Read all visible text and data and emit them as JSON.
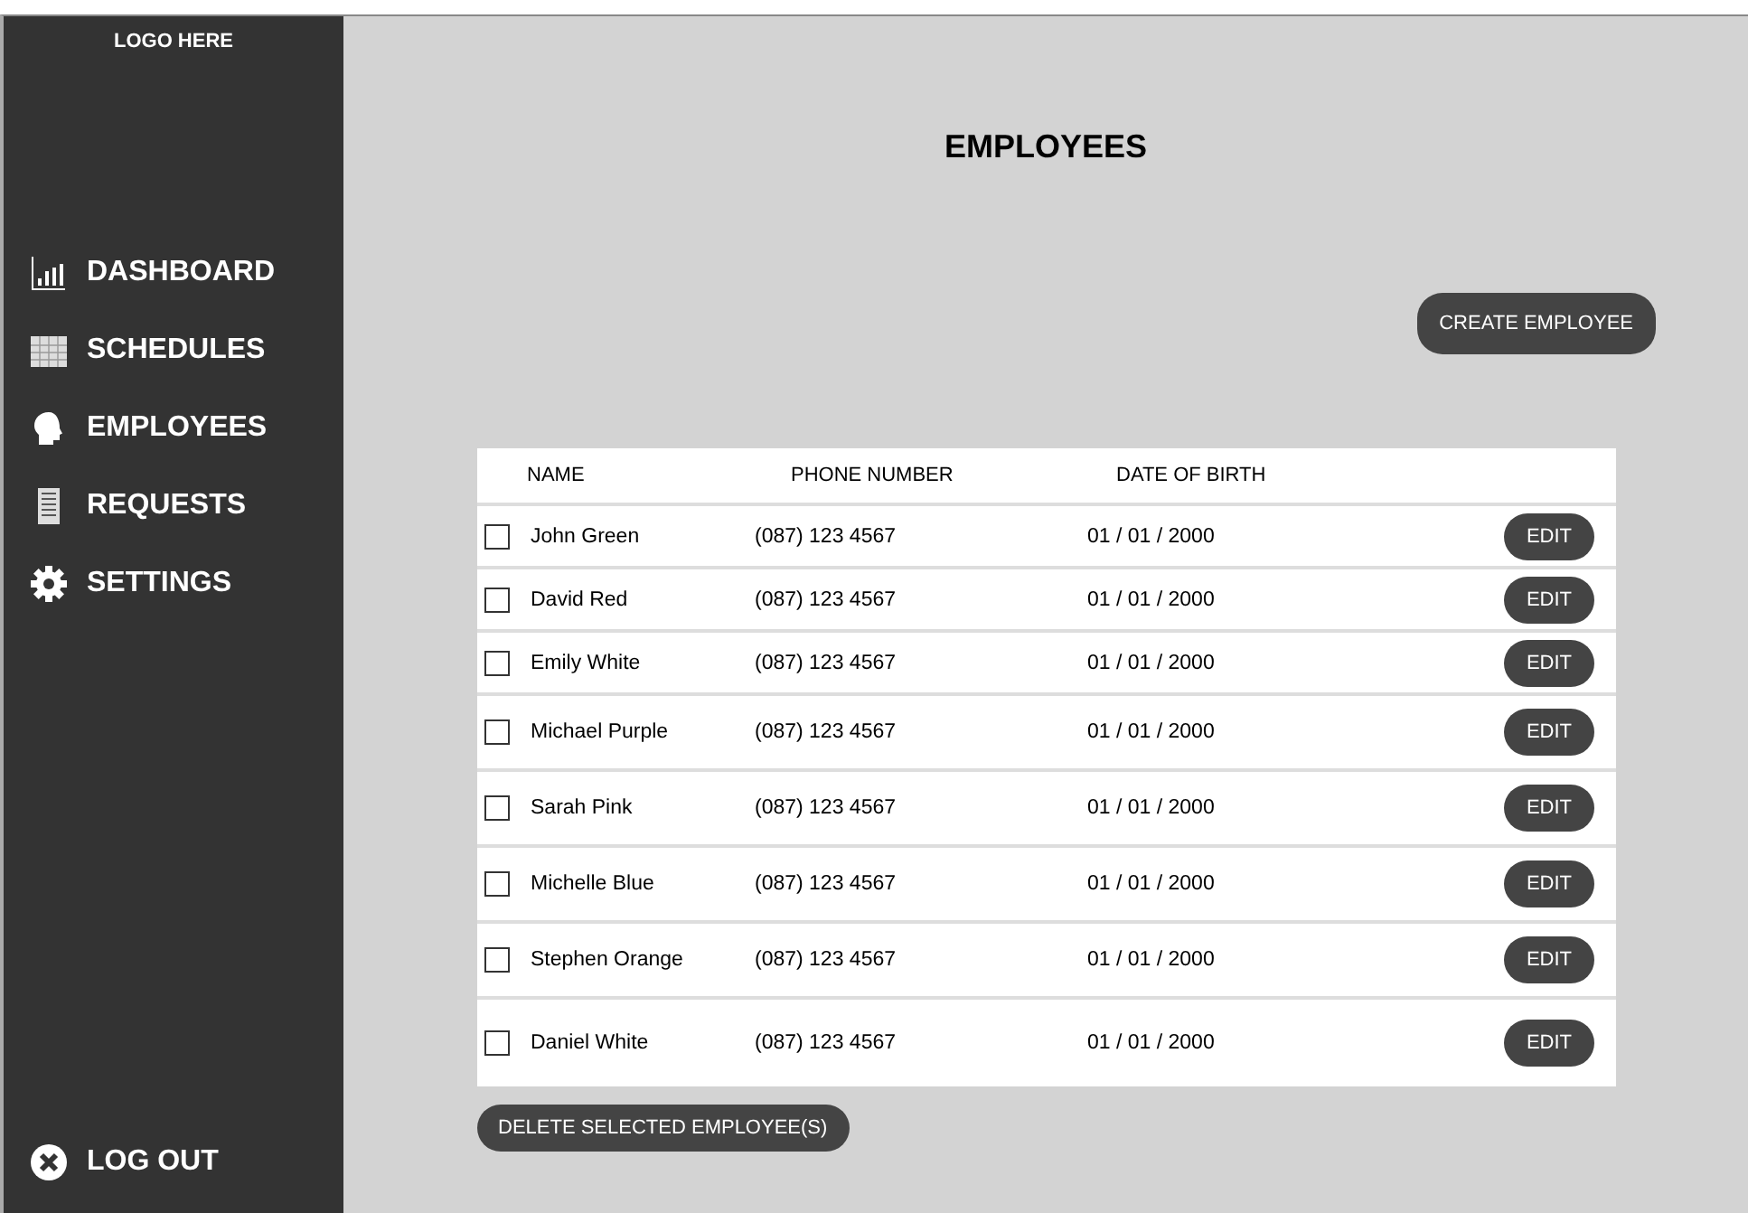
{
  "sidebar": {
    "logo": "LOGO HERE",
    "items": [
      {
        "label": "DASHBOARD",
        "kind": "chart"
      },
      {
        "label": "SCHEDULES",
        "kind": "calendar"
      },
      {
        "label": "EMPLOYEES",
        "kind": "head"
      },
      {
        "label": "REQUESTS",
        "kind": "document"
      },
      {
        "label": "SETTINGS",
        "kind": "gear"
      }
    ],
    "logout": "LOG OUT"
  },
  "title": "EMPLOYEES",
  "create_button": "CREATE EMPLOYEE",
  "table": {
    "columns": [
      "NAME",
      "PHONE NUMBER",
      "DATE OF BIRTH"
    ],
    "rows": [
      {
        "name": "John Green",
        "phone": "(087) 123 4567",
        "dob": "01 / 01 / 2000",
        "checked": false,
        "action": "EDIT"
      },
      {
        "name": "David Red",
        "phone": "(087) 123 4567",
        "dob": "01 / 01 / 2000",
        "checked": false,
        "action": "EDIT"
      },
      {
        "name": "Emily White",
        "phone": "(087) 123 4567",
        "dob": "01 / 01 / 2000",
        "checked": false,
        "action": "EDIT"
      },
      {
        "name": "Michael Purple",
        "phone": "(087) 123 4567",
        "dob": "01 / 01 / 2000",
        "checked": false,
        "action": "EDIT"
      },
      {
        "name": "Sarah Pink",
        "phone": "(087) 123 4567",
        "dob": "01 / 01 / 2000",
        "checked": false,
        "action": "EDIT"
      },
      {
        "name": "Michelle Blue",
        "phone": "(087) 123 4567",
        "dob": "01 / 01 / 2000",
        "checked": false,
        "action": "EDIT"
      },
      {
        "name": "Stephen Orange",
        "phone": "(087) 123 4567",
        "dob": "01 / 01 / 2000",
        "checked": false,
        "action": "EDIT"
      },
      {
        "name": "Daniel White",
        "phone": "(087) 123 4567",
        "dob": "01 / 01 / 2000",
        "checked": false,
        "action": "EDIT"
      }
    ]
  },
  "delete_button": "DELETE SELECTED EMPLOYEE(S)"
}
